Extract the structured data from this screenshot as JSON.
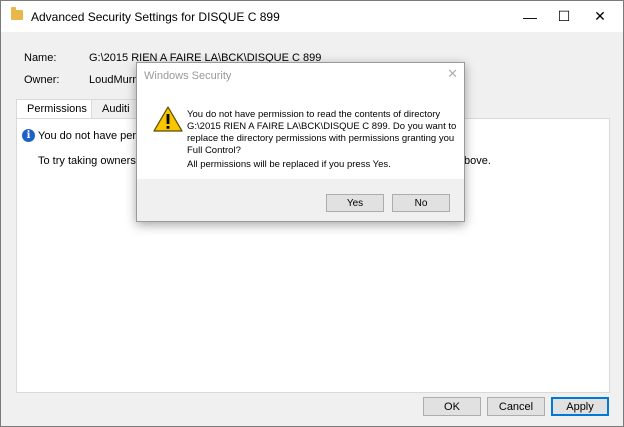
{
  "window": {
    "title": "Advanced Security Settings for DISQUE C 899",
    "minimize_glyph": "—",
    "maximize_glyph": "☐",
    "close_glyph": "✕"
  },
  "fields": {
    "name_label": "Name:",
    "name_value": "G:\\2015 RIEN A FAIRE LA\\BCK\\DISQUE C 899",
    "owner_label": "Owner:",
    "owner_value": "LoudMurmu"
  },
  "tabs": [
    {
      "label": "Permissions"
    },
    {
      "label": "Auditi"
    }
  ],
  "panel": {
    "info_text": "You do not have permis",
    "owner_hint_start": "To try taking ownership",
    "owner_hint_end": "bove."
  },
  "footer": {
    "ok_label": "OK",
    "cancel_label": "Cancel",
    "apply_label": "Apply"
  },
  "dialog": {
    "title": "Windows Security",
    "close_glyph": "✕",
    "message": "You do not have permission to read the contents of directory G:\\2015 RIEN A FAIRE LA\\BCK\\DISQUE C 899. Do you want to replace the directory permissions with permissions granting you Full Control?",
    "note": "All permissions will be replaced if you press Yes.",
    "yes_label": "Yes",
    "no_label": "No",
    "icon": "warning-icon"
  },
  "colors": {
    "accent": "#0078d7",
    "info_icon": "#1e62c8",
    "warning": "#f7c600"
  }
}
